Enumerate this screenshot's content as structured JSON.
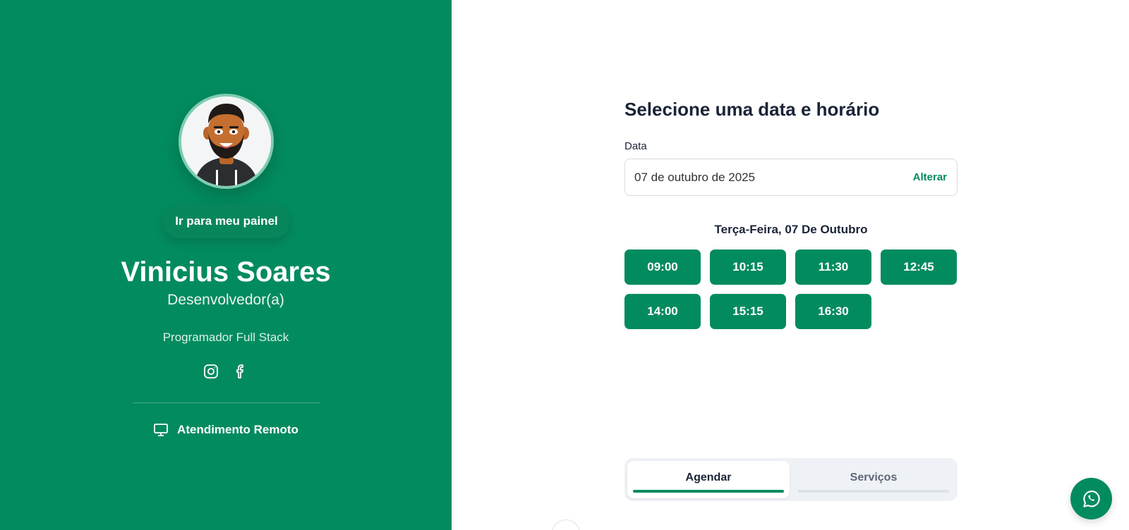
{
  "profile": {
    "panel_button": "Ir para meu painel",
    "name": "Vinicius Soares",
    "role": "Desenvolvedor(a)",
    "bio": "Programador Full Stack",
    "socials": [
      "instagram-icon",
      "facebook-icon"
    ],
    "service_mode": "Atendimento Remoto"
  },
  "booking": {
    "title": "Selecione uma data e horário",
    "date_label": "Data",
    "date_value": "07 de outubro de 2025",
    "change_label": "Alterar",
    "day_heading": "Terça-Feira, 07 De Outubro",
    "slots": [
      "09:00",
      "10:15",
      "11:30",
      "12:45",
      "14:00",
      "15:15",
      "16:30"
    ]
  },
  "tabs": [
    {
      "label": "Agendar",
      "active": true
    },
    {
      "label": "Serviços",
      "active": false
    }
  ],
  "colors": {
    "brand": "#038b60",
    "text_dark": "#1b2437"
  }
}
